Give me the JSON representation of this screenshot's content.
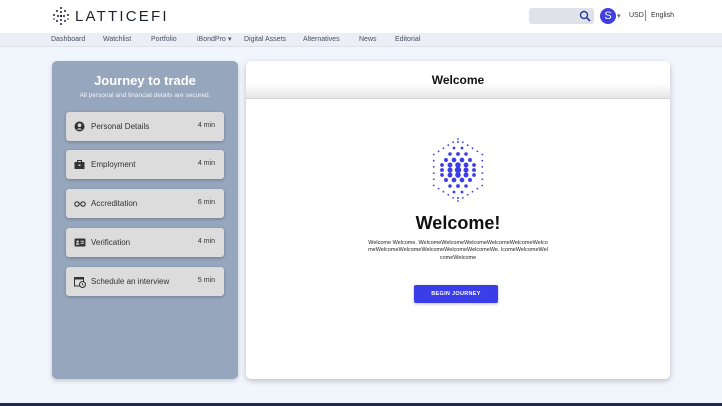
{
  "app": {
    "logo_text": "LATTICEFI"
  },
  "header": {
    "search_placeholder": "",
    "avatar_initial": "S",
    "currency": "USD",
    "language": "English"
  },
  "nav": {
    "items": [
      "Dashboard",
      "Watchlist",
      "Portfolio",
      "iBondPro",
      "Digital Assets",
      "Alternatives",
      "News",
      "Editorial"
    ]
  },
  "journey": {
    "title": "Journey to trade",
    "subtitle": "All personal and financial details are secured.",
    "steps": [
      {
        "label": "Personal Details",
        "time": "4 min",
        "icon": "person-circle-icon"
      },
      {
        "label": "Employment",
        "time": "4 min",
        "icon": "briefcase-icon"
      },
      {
        "label": "Accreditation",
        "time": "6 min",
        "icon": "glasses-icon"
      },
      {
        "label": "Verification",
        "time": "4 min",
        "icon": "id-card-icon"
      },
      {
        "label": "Schedule an interview",
        "time": "5 min",
        "icon": "calendar-clock-icon"
      }
    ]
  },
  "main": {
    "header_title": "Welcome",
    "heading": "Welcome!",
    "body": "Welcome Welcome. WelcomeWelcomeWelcomeWelcomeWelcomeWelcomeWelcomeWelcomeWelcomeWelcomeWelcomeWe. lcomeWelcomeWelcomeWelcome",
    "button_label": "BEGIN JOURNEY"
  },
  "colors": {
    "accent": "#3b3ee8",
    "panel": "#96a6bd",
    "step_bg": "#dcdcdc"
  }
}
